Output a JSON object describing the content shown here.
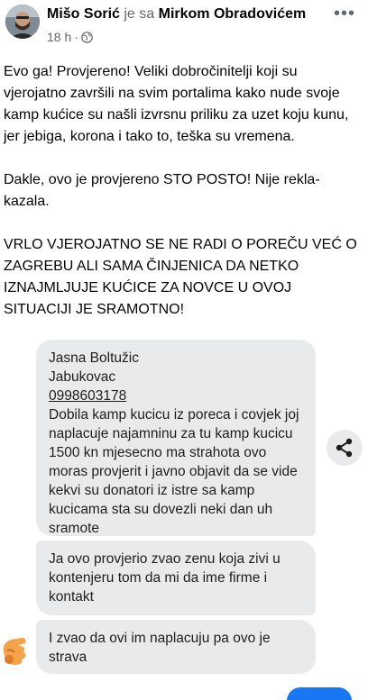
{
  "header": {
    "author": "Mišo Sorić",
    "connector": "je sa",
    "tagged": "Mirkom Obradovićem",
    "time": "18 h",
    "separator": "·",
    "more": "•••"
  },
  "post": {
    "paragraphs": [
      "Evo ga! Provjereno! Veliki dobročinitelji koji su vjerojatno završili na svim portalima kako nude svoje kamp kućice su našli izvrsnu priliku za uzet koju kunu, jer jebiga, korona i tako to, teška su vremena.",
      "Dakle, ovo je provjereno STO POSTO! Nije rekla-kazala.",
      "VRLO VJEROJATNO SE NE RADI O POREČU VEĆ O ZAGREBU ALI SAMA ČINJENICA DA NETKO IZNAJMLJUJE KUĆICE ZA NOVCE U OVOJ SITUACIJI JE SRAMOTNO!"
    ]
  },
  "messages": {
    "bubble1": {
      "line1": "Jasna Boltužic",
      "line2": "Jabukovac",
      "phone": "0998603178",
      "text": "Dobila kamp kucicu iz poreca i covjek joj naplacuje najamninu za tu kamp kucicu 1500 kn mjesecno ma strahota ovo moras provjerit i javno objavit da se vide kekvi su donatori iz istre sa kamp kucicama sta su dovezli neki dan uh sramote"
    },
    "bubble2": "Ja ovo provjerio zvao zenu koja zivi u kontenjeru tom da mi da ime firme i kontakt",
    "bubble3": "I zvao da ovi im naplacuju pa ovo je strava"
  },
  "icons": {
    "share": "share-icon",
    "globe": "globe-icon",
    "avatar": "avatar",
    "sticker": "sticker-icon"
  },
  "colors": {
    "bubble": "#e9eaec",
    "meta": "#65676b",
    "accent": "#1877f2"
  }
}
